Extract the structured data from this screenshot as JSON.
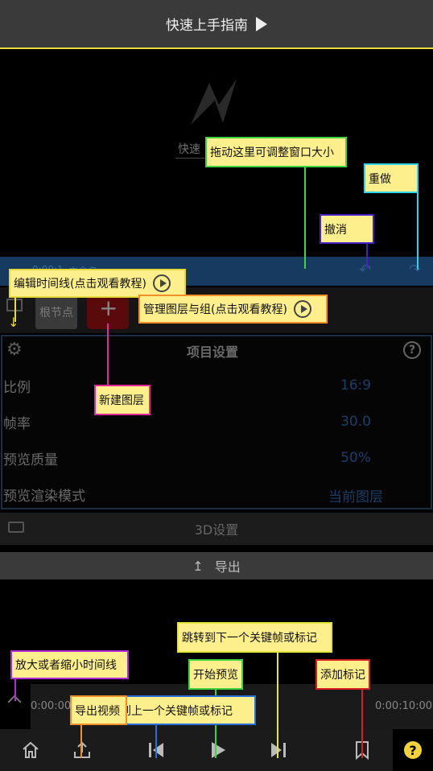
{
  "header": {
    "title": "快速上手指南"
  },
  "preview": {
    "logo_text": "快速"
  },
  "timeline_bar": {
    "time": "0:00:1",
    "name": "未命名"
  },
  "layer_row": {
    "root_label": "根节点",
    "plus": "+"
  },
  "settings": {
    "title": "项目设置",
    "help": "?",
    "rows": [
      {
        "label": "比例",
        "value": "16:9"
      },
      {
        "label": "帧率",
        "value": "30.0"
      },
      {
        "label": "预览质量",
        "value": "50%"
      },
      {
        "label": "预览渲染模式",
        "value": "当前图层"
      }
    ]
  },
  "s3d": {
    "label": "3D设置"
  },
  "export": {
    "label": "导出",
    "icon": "↥"
  },
  "ruler": {
    "start": "0:00:00",
    "end": "0:00:10:00"
  },
  "toolbar": {
    "help": "?"
  },
  "annotations": {
    "resize": "拖动这里可调整窗口大小",
    "redo": "重做",
    "undo": "撤消",
    "edit_timeline": "编辑时间线(点击观看教程)",
    "manage_layers": "管理图层与组(点击观看教程)",
    "new_layer": "新建图层",
    "next_keyframe": "跳转到下一个关键帧或标记",
    "zoom": "放大或者缩小时间线",
    "play": "开始预览",
    "add_marker": "添加标记",
    "export_video": "导出视频",
    "prev_keyframe": "跳转到上一个关键帧或标记"
  },
  "colors": {
    "accent_yellow": "#e6d93a",
    "note_bg": "#fdf08c",
    "green": "#3fd43f",
    "cyan": "#2fd2e6",
    "purple": "#4a1fc7",
    "orange": "#f0902a",
    "magenta": "#e02a9c",
    "red": "#d42020",
    "blue": "#2a6fd8"
  }
}
